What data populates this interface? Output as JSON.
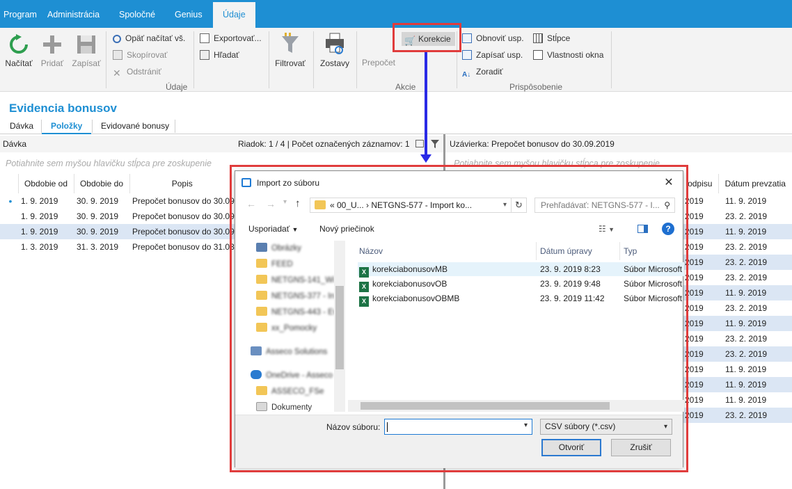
{
  "menu": [
    "Program",
    "Administrácia",
    "Spoločné",
    "Genius",
    "Údaje"
  ],
  "ribbon": {
    "big": {
      "load": "Načítať",
      "add": "Pridať",
      "write": "Zapísať",
      "filter": "Filtrovať",
      "reports": "Zostavy",
      "recalc": "Prepočet"
    },
    "small": {
      "reload": "Opäť načítať vš.",
      "copy": "Skopírovať",
      "delete": "Odstrániť",
      "export": "Exportovať...",
      "find": "Hľadať",
      "corrections": "Korekcie",
      "refresh_layout": "Obnoviť usp.",
      "save_layout": "Zapísať usp.",
      "sort": "Zoradiť",
      "columns": "Stĺpce",
      "window_props": "Vlastnosti okna"
    },
    "groups": {
      "data": "Údaje",
      "actions": "Akcie",
      "customize": "Prispôsobenie"
    }
  },
  "page": {
    "title": "Evidencia bonusov",
    "tabs": [
      "Dávka",
      "Položky",
      "Evidované bonusy"
    ]
  },
  "left_panel": {
    "title": "Dávka",
    "status": "Riadok: 1 / 4 | Počet označených záznamov: 1",
    "group_hint": "Potiahnite sem myšou hlavičku stĺpca pre zoskupenie",
    "columns": [
      "Obdobie od",
      "Obdobie do",
      "Popis"
    ],
    "rows": [
      [
        "1. 9. 2019",
        "30. 9. 2019",
        "Prepočet bonusov do 30.09"
      ],
      [
        "1. 9. 2019",
        "30. 9. 2019",
        "Prepočet bonusov do 30.09"
      ],
      [
        "1. 9. 2019",
        "30. 9. 2019",
        "Prepočet bonusov do 30.09"
      ],
      [
        "1. 3. 2019",
        "31. 3. 2019",
        "Prepočet bonusov do 31.03"
      ]
    ]
  },
  "right_panel": {
    "title": "Uzávierka: Prepočet bonusov do 30.09.2019",
    "group_hint": "Potiahnite sem myšou hlavičku stĺpca pre zoskupenie",
    "columns": [
      "odpisu",
      "Dátum prevzatia"
    ],
    "rows": [
      [
        "2019",
        "11. 9. 2019"
      ],
      [
        "2019",
        "23. 2. 2019"
      ],
      [
        "2019",
        "11. 9. 2019"
      ],
      [
        "2019",
        "23. 2. 2019"
      ],
      [
        "2019",
        "23. 2. 2019"
      ],
      [
        "2019",
        "23. 2. 2019"
      ],
      [
        "2019",
        "11. 9. 2019"
      ],
      [
        "2019",
        "23. 2. 2019"
      ],
      [
        "2019",
        "11. 9. 2019"
      ],
      [
        "2019",
        "23. 2. 2019"
      ],
      [
        "2019",
        "23. 2. 2019"
      ],
      [
        "2019",
        "11. 9. 2019"
      ],
      [
        "2019",
        "11. 9. 2019"
      ],
      [
        "2019",
        "11. 9. 2019"
      ],
      [
        "2019",
        "23. 2. 2019"
      ]
    ]
  },
  "dialog": {
    "title": "Import zo súboru",
    "address": "«  00_U...  ›  NETGNS-577 - Import ko...",
    "search_placeholder": "Prehľadávať: NETGNS-577 - I...",
    "organize": "Usporiadať",
    "new_folder": "Nový priečinok",
    "nav_items": [
      "Obrázky",
      "FEED",
      "NETGNS-141_Wi",
      "NETGNS-377 - In",
      "NETGNS-443 - Ev",
      "xx_Pomocky",
      "Asseco Solutions",
      "OneDrive - Asseco",
      "ASSECO_FSe",
      "Dokumenty"
    ],
    "columns": {
      "name": "Názov",
      "date": "Dátum úpravy",
      "type": "Typ"
    },
    "files": [
      {
        "name": "korekciabonusovMB",
        "date": "23. 9. 2019 8:23",
        "type": "Súbor Microsoft"
      },
      {
        "name": "korekciabonusovOB",
        "date": "23. 9. 2019 9:48",
        "type": "Súbor Microsoft"
      },
      {
        "name": "korekciabonusovOBMB",
        "date": "23. 9. 2019 11:42",
        "type": "Súbor Microsoft"
      }
    ],
    "filename_label": "Názov súboru:",
    "filename_value": "",
    "filetype": "CSV súbory (*.csv)",
    "open": "Otvoriť",
    "cancel": "Zrušiť"
  }
}
